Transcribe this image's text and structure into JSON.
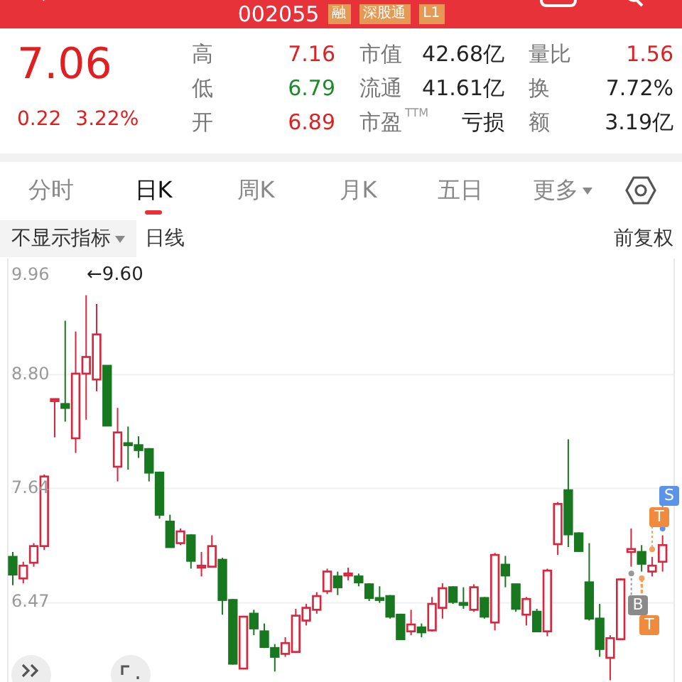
{
  "header": {
    "code": "002055",
    "tags": [
      "融",
      "深股通",
      "L1"
    ]
  },
  "quote": {
    "price": "7.06",
    "change": "0.22",
    "change_pct": "3.22%",
    "color": "#e02020"
  },
  "stats": [
    {
      "label": "高",
      "value": "7.16",
      "color": "#e02020"
    },
    {
      "label": "市值",
      "value": "42.68亿",
      "color": "#222222"
    },
    {
      "label": "量比",
      "value": "1.56",
      "color": "#e02020"
    },
    {
      "label": "低",
      "value": "6.79",
      "color": "#1a8a2a"
    },
    {
      "label": "流通",
      "value": "41.61亿",
      "color": "#222222"
    },
    {
      "label": "换",
      "value": "7.72%",
      "color": "#222222"
    },
    {
      "label": "开",
      "value": "6.89",
      "color": "#e02020"
    },
    {
      "label": "市盈",
      "sup": "TTM",
      "value": "亏损",
      "color": "#222222"
    },
    {
      "label": "额",
      "value": "3.19亿",
      "color": "#222222"
    }
  ],
  "tabs": [
    {
      "label": "分时",
      "selected": false,
      "dropdown": false
    },
    {
      "label": "日K",
      "selected": true,
      "dropdown": false
    },
    {
      "label": "周K",
      "selected": false,
      "dropdown": false
    },
    {
      "label": "月K",
      "selected": false,
      "dropdown": false
    },
    {
      "label": "五日",
      "selected": false,
      "dropdown": false
    },
    {
      "label": "更多",
      "selected": false,
      "dropdown": true
    }
  ],
  "indicator": {
    "selector": "不显示指标",
    "period": "日线",
    "adjust": "前复权"
  },
  "chart": {
    "high_label": "←9.60",
    "markers": [
      {
        "label": "S",
        "kind": "sell"
      },
      {
        "label": "T",
        "kind": "t"
      },
      {
        "label": "B",
        "kind": "buy"
      },
      {
        "label": "T",
        "kind": "t"
      }
    ],
    "chart_data": {
      "type": "candlestick",
      "grid": true,
      "ylim": [
        5.634,
        9.984
      ],
      "yticks": [
        {
          "value": 9.96,
          "label": "9.96"
        },
        {
          "value": 8.8,
          "label": "8.80"
        },
        {
          "value": 7.64,
          "label": "7.64"
        },
        {
          "value": 6.47,
          "label": "6.47"
        }
      ],
      "ohlc": [
        [
          6.94,
          6.99,
          6.65,
          6.76
        ],
        [
          6.72,
          6.89,
          6.67,
          6.85
        ],
        [
          6.88,
          7.08,
          6.84,
          7.05
        ],
        [
          7.05,
          7.78,
          7.01,
          7.76
        ],
        [
          8.53,
          8.55,
          8.16,
          8.55
        ],
        [
          8.5,
          9.35,
          8.32,
          8.46
        ],
        [
          8.15,
          9.24,
          8.0,
          8.81
        ],
        [
          8.81,
          9.61,
          8.34,
          8.98
        ],
        [
          8.75,
          9.52,
          8.63,
          9.21
        ],
        [
          8.89,
          8.89,
          8.28,
          8.28
        ],
        [
          7.86,
          8.46,
          7.71,
          8.21
        ],
        [
          8.1,
          8.27,
          7.83,
          8.08
        ],
        [
          8.08,
          8.17,
          7.95,
          8.03
        ],
        [
          8.04,
          8.05,
          7.71,
          7.8
        ],
        [
          7.8,
          7.81,
          7.33,
          7.37
        ],
        [
          7.3,
          7.37,
          7.04,
          7.04
        ],
        [
          7.08,
          7.23,
          7.06,
          7.2
        ],
        [
          7.16,
          7.17,
          6.82,
          6.9
        ],
        [
          6.83,
          6.99,
          6.74,
          6.85
        ],
        [
          6.84,
          7.16,
          6.83,
          7.05
        ],
        [
          6.91,
          6.93,
          6.35,
          6.5
        ],
        [
          6.5,
          6.51,
          5.84,
          5.85
        ],
        [
          5.8,
          6.33,
          5.8,
          6.33
        ],
        [
          6.36,
          6.4,
          6.14,
          6.21
        ],
        [
          6.18,
          6.26,
          6.01,
          6.02
        ],
        [
          6.01,
          6.05,
          5.77,
          5.92
        ],
        [
          5.95,
          6.12,
          5.92,
          6.06
        ],
        [
          5.97,
          6.41,
          5.96,
          6.34
        ],
        [
          6.29,
          6.46,
          6.24,
          6.42
        ],
        [
          6.4,
          6.58,
          6.36,
          6.54
        ],
        [
          6.59,
          6.82,
          6.56,
          6.79
        ],
        [
          6.74,
          6.79,
          6.55,
          6.63
        ],
        [
          6.75,
          6.83,
          6.7,
          6.77
        ],
        [
          6.74,
          6.77,
          6.64,
          6.68
        ],
        [
          6.66,
          6.67,
          6.49,
          6.52
        ],
        [
          6.52,
          6.64,
          6.47,
          6.5
        ],
        [
          6.54,
          6.55,
          6.31,
          6.33
        ],
        [
          6.35,
          6.36,
          6.1,
          6.1
        ],
        [
          6.18,
          6.4,
          6.14,
          6.25
        ],
        [
          6.22,
          6.26,
          6.12,
          6.17
        ],
        [
          6.19,
          6.53,
          6.18,
          6.46
        ],
        [
          6.42,
          6.67,
          6.31,
          6.62
        ],
        [
          6.63,
          6.64,
          6.46,
          6.48
        ],
        [
          6.47,
          6.63,
          6.41,
          6.45
        ],
        [
          6.4,
          6.66,
          6.38,
          6.63
        ],
        [
          6.52,
          6.53,
          6.31,
          6.33
        ],
        [
          6.27,
          6.98,
          6.19,
          6.96
        ],
        [
          6.86,
          6.95,
          6.63,
          6.75
        ],
        [
          6.66,
          6.66,
          6.38,
          6.41
        ],
        [
          6.35,
          6.53,
          6.24,
          6.51
        ],
        [
          6.38,
          6.41,
          6.17,
          6.18
        ],
        [
          6.18,
          6.82,
          6.13,
          6.8
        ],
        [
          7.07,
          7.5,
          6.96,
          7.48
        ],
        [
          7.62,
          8.14,
          7.04,
          7.17
        ],
        [
          7.18,
          7.19,
          6.99,
          7.0
        ],
        [
          6.68,
          7.08,
          6.29,
          6.31
        ],
        [
          6.31,
          6.46,
          5.92,
          6.0
        ],
        [
          5.91,
          6.14,
          5.68,
          6.11
        ],
        [
          6.1,
          6.72,
          6.09,
          6.71
        ],
        [
          6.99,
          7.23,
          6.84,
          7.02
        ],
        [
          6.99,
          7.06,
          6.79,
          6.87
        ],
        [
          6.79,
          6.94,
          6.74,
          6.85
        ],
        [
          6.89,
          7.16,
          6.79,
          7.06
        ]
      ]
    }
  }
}
